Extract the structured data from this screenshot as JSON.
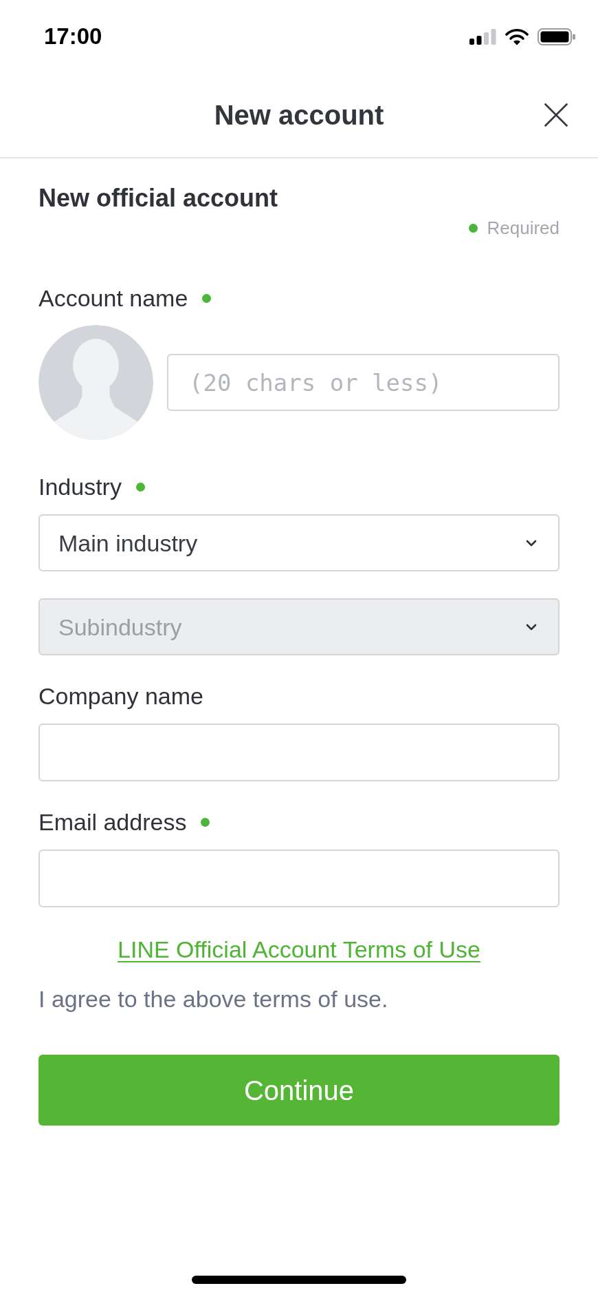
{
  "status_bar": {
    "time": "17:00"
  },
  "header": {
    "title": "New account"
  },
  "form": {
    "title": "New official account",
    "required_legend": "Required",
    "fields": [
      {
        "kind": "avatar_text",
        "label": "Account name",
        "required": true,
        "placeholder": "(20 chars or less)"
      },
      {
        "kind": "select",
        "label": "Industry",
        "required": true,
        "selects": [
          {
            "value": "Main industry",
            "disabled": false
          },
          {
            "value": "Subindustry",
            "disabled": true
          }
        ]
      },
      {
        "kind": "text",
        "label": "Company name",
        "required": false
      },
      {
        "kind": "text",
        "label": "Email address",
        "required": true
      }
    ]
  },
  "terms": {
    "link": "LINE Official Account Terms of Use",
    "agreement": "I agree to the above terms of use."
  },
  "continue_button": {
    "label": "Continue"
  }
}
